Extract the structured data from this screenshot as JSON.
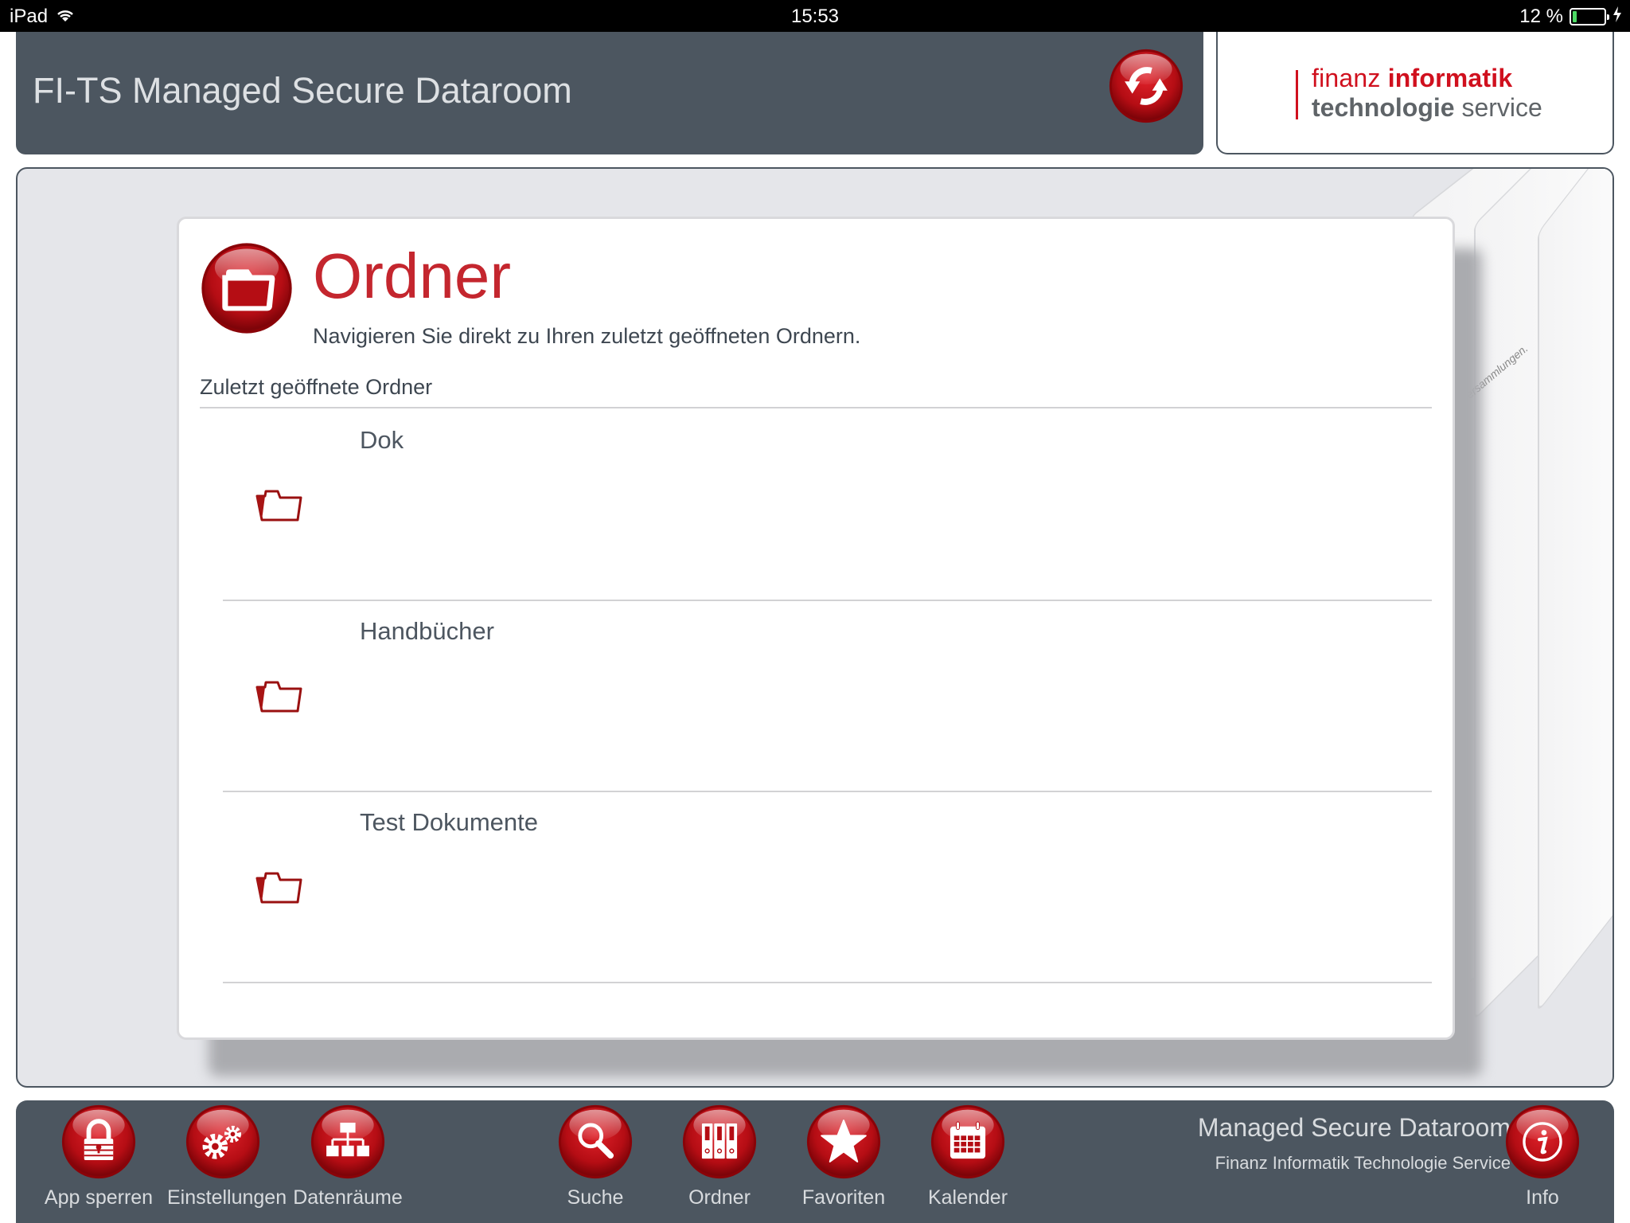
{
  "status_bar": {
    "device": "iPad",
    "time": "15:53",
    "battery_text": "12 %",
    "battery_level": 0.12
  },
  "header": {
    "title": "FI-TS Managed Secure Dataroom",
    "sync_button": "sync-icon"
  },
  "logo": {
    "line1_light": "finanz ",
    "line1_bold": "informatik",
    "line2_bold": "technologie",
    "line2_light": " service",
    "colors": {
      "red": "#d0101e",
      "gray": "#5f6468"
    }
  },
  "page": {
    "title": "Ordner",
    "subtitle": "Navigieren Sie direkt zu Ihren zuletzt geöffneten Ordnern.",
    "section_label": "Zuletzt geöffnete Ordner",
    "background_hint_text": "...ersammlungen.",
    "recent_folders": [
      {
        "name": "Dok",
        "icon": "folder-open-icon"
      },
      {
        "name": "Handbücher",
        "icon": "folder-open-icon"
      },
      {
        "name": "Test Dokumente",
        "icon": "folder-open-icon"
      }
    ]
  },
  "toolbar": {
    "items": [
      {
        "label": "App sperren",
        "icon": "lock-icon"
      },
      {
        "label": "Einstellungen",
        "icon": "gears-icon"
      },
      {
        "label": "Datenräume",
        "icon": "hierarchy-icon"
      },
      {
        "label": "Suche",
        "icon": "search-icon"
      },
      {
        "label": "Ordner",
        "icon": "binders-icon"
      },
      {
        "label": "Favoriten",
        "icon": "star-icon"
      },
      {
        "label": "Kalender",
        "icon": "calendar-icon"
      }
    ],
    "brand_title": "Managed Secure Dataroom",
    "brand_subtitle": "Finanz Informatik Technologie Service",
    "info_label": "Info"
  },
  "colors": {
    "accent_red": "#c4262e",
    "bar_gray": "#4c5660",
    "panel_bg": "#e5e6ea"
  }
}
